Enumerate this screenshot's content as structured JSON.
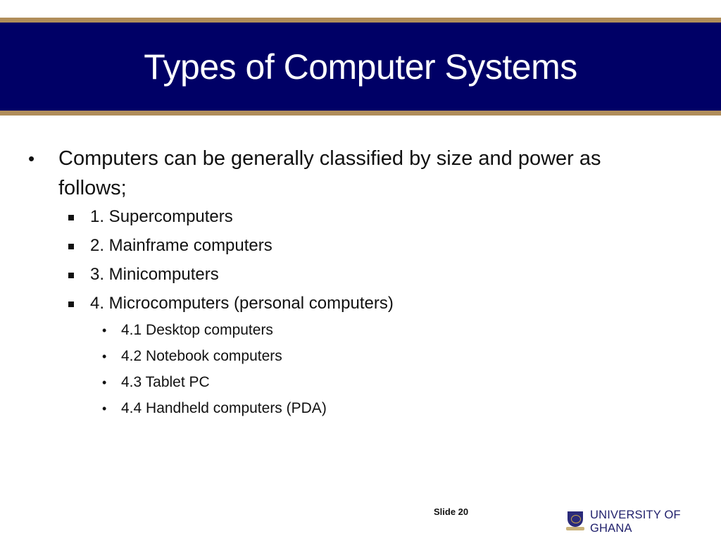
{
  "slide": {
    "title": "Types of Computer Systems",
    "intro": "Computers can be generally classified by size and power as follows;",
    "categories": [
      "1. Supercomputers",
      "2. Mainframe computers",
      "3. Minicomputers",
      "4. Microcomputers (personal computers)"
    ],
    "microcomputer_types": [
      "4.1 Desktop computers",
      "4.2 Notebook computers",
      "4.3 Tablet PC",
      "4.4 Handheld computers (PDA)"
    ],
    "slide_number": "Slide 20"
  },
  "branding": {
    "institution": "UNIVERSITY OF GHANA",
    "header_color": "#000066",
    "accent_color": "#b08d5a"
  },
  "glyphs": {
    "round_bullet": "•"
  }
}
